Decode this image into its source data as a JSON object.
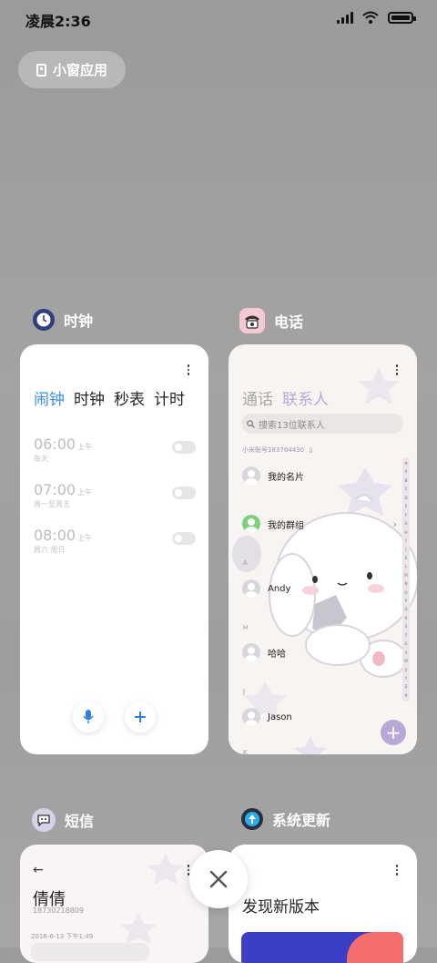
{
  "status_bar": {
    "time": "凌晨2:36"
  },
  "small_window": {
    "label": "小窗应用"
  },
  "apps": [
    {
      "name": "时钟"
    },
    {
      "name": "电话"
    },
    {
      "name": "短信"
    },
    {
      "name": "系统更新"
    }
  ],
  "clock": {
    "tabs": [
      "闹钟",
      "时钟",
      "秒表",
      "计时"
    ],
    "alarms": [
      {
        "time": "06:00",
        "ampm": "上午",
        "repeat": "每天",
        "enabled": false
      },
      {
        "time": "07:00",
        "ampm": "上午",
        "repeat": "周一至周五",
        "enabled": false
      },
      {
        "time": "08:00",
        "ampm": "上午",
        "repeat": "周六 周日",
        "enabled": false
      }
    ]
  },
  "contacts": {
    "tabs": [
      "通话",
      "联系人"
    ],
    "search_placeholder": "搜索13位联系人",
    "account": "小米账号183704430",
    "my_card": "我的名片",
    "my_groups": "我的群组",
    "sections": [
      "A",
      "H",
      "J",
      "K"
    ],
    "entries": [
      "Andy",
      "哈哈",
      "Jason"
    ],
    "alpha_index": [
      "♥",
      "A",
      "B",
      "C",
      "D",
      "E",
      "F",
      "G",
      "H",
      "I",
      "J",
      "K",
      "L",
      "M",
      "N",
      "O",
      "P",
      "Q",
      "R",
      "S",
      "T",
      "U",
      "V",
      "W",
      "X",
      "Y",
      "Z",
      "#"
    ]
  },
  "sms": {
    "contact_name": "倩倩",
    "number": "18730218809",
    "date": "2016-6-13 下午1:49"
  },
  "update": {
    "title": "发现新版本"
  },
  "colors": {
    "accent_blue": "#3a8ee6",
    "contacts_purple": "#b8a8d8"
  }
}
